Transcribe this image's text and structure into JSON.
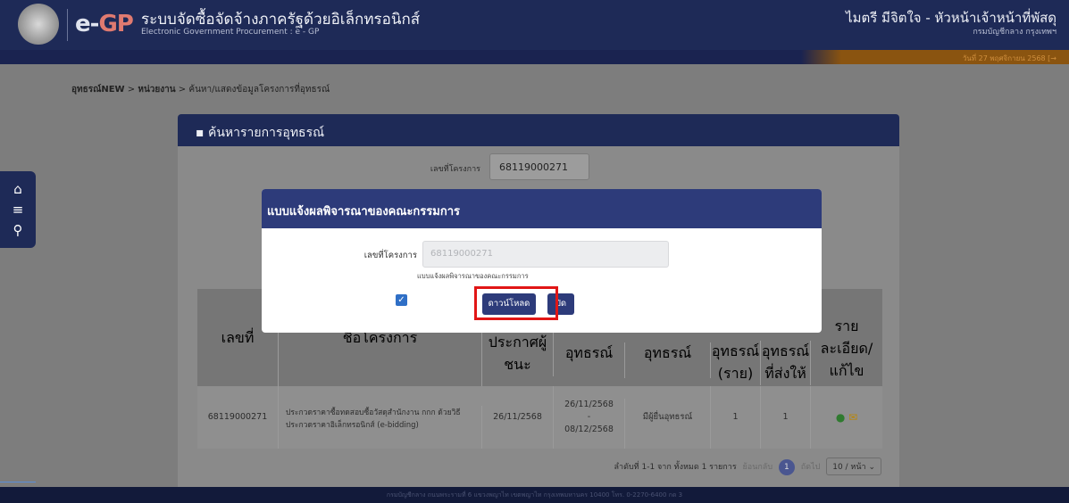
{
  "header": {
    "logo_prefix": "e-",
    "logo_suffix": "GP",
    "title_th": "ระบบจัดซื้อจัดจ้างภาครัฐด้วยอิเล็กทรอนิกส์",
    "title_en": "Electronic Government Procurement : e - GP",
    "user_name": "ไมตรี มีจิตใจ - หัวหน้าเจ้าหน้าที่พัสดุ",
    "user_dept": "กรมบัญชีกลาง กรุงเทพฯ",
    "date": "วันที่ 27 พฤศจิกายน 2568"
  },
  "breadcrumb": {
    "item1": "อุทธรณ์NEW",
    "sep": ">",
    "item2": "หน่วยงาน",
    "item3": "ค้นหา/แสดงข้อมูลโครงการที่อุทธรณ์"
  },
  "panel": {
    "title": "ค้นหารายการอุทธรณ์",
    "project_label": "เลขที่โครงการ",
    "project_value": "68119000271"
  },
  "table": {
    "headers": [
      "เลขที่โครงการ",
      "ชื่อโครงการ",
      "ประกาศผู้ชนะ",
      "อุทธรณ์",
      "อุทธรณ์",
      "อุทธรณ์ (ราย)",
      "อุทธรณ์ที่ส่งให้ กวจ.",
      "ราย ละเอียด/ แก้ไข"
    ],
    "row": {
      "project_no": "68119000271",
      "project_name": "ประกวดราคาซื้อทดสอบซื้อวัสดุสำนักงาน กกก ด้วยวิธีประกวดราคาอิเล็กทรอนิกส์ (e-bidding)",
      "announce_date": "26/11/2568",
      "appeal_start": "26/11/2568",
      "dash": "-",
      "appeal_end": "08/12/2568",
      "status": "มีผู้ยื่นอุทธรณ์",
      "count1": "1",
      "count2": "1"
    }
  },
  "pager": {
    "summary": "ลำดับที่ 1-1 จาก ทั้งหมด 1 รายการ",
    "prev": "ย้อนกลับ",
    "page": "1",
    "next": "ถัดไป",
    "per_page": "10 / หน้า"
  },
  "footer": {
    "text": "กรมบัญชีกลาง ถนนพระรามที่ 6 แขวงพญาไท เขตพญาไท กรุงเทพมหานคร 10400 โทร. 0-2270-6400 กด 3"
  },
  "modal": {
    "title": "แบบแจ้งผลพิจารณาของคณะกรรมการ",
    "project_label": "เลขที่โครงการ",
    "project_value": "68119000271",
    "checkbox_label": "แบบแจ้งผลพิจารณาของคณะกรรมการ",
    "download_label": "ดาวน์โหลด",
    "close_label": "ปิด"
  },
  "colors": {
    "header_bg": "#1e2a57",
    "modal_header": "#2d3b7a",
    "highlight": "#e11616",
    "checkbox": "#2f6fc6"
  }
}
